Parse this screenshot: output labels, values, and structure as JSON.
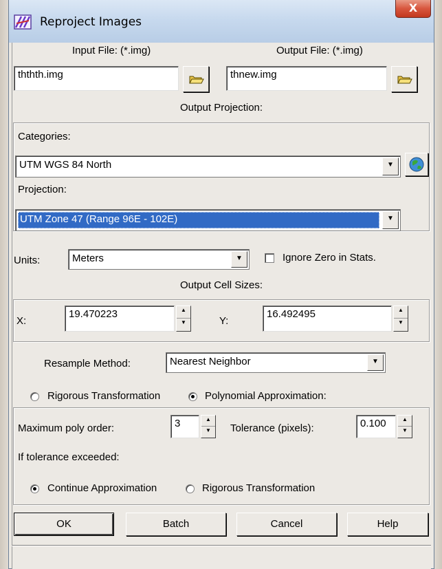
{
  "window": {
    "title": "Reproject Images",
    "close_label": "X"
  },
  "files": {
    "input_label": "Input File: (*.img)",
    "input_value": "ththth.img",
    "output_label": "Output File: (*.img)",
    "output_value": "thnew.img"
  },
  "projection": {
    "section_label": "Output Projection:",
    "categories_label": "Categories:",
    "categories_value": "UTM WGS 84 North",
    "projection_label": "Projection:",
    "projection_value": "UTM Zone 47  (Range 96E - 102E)"
  },
  "units": {
    "label": "Units:",
    "value": "Meters",
    "ignore_zero_label": "Ignore Zero in Stats.",
    "ignore_zero_checked": false
  },
  "cell_sizes": {
    "section_label": "Output Cell Sizes:",
    "x_label": "X:",
    "x_value": "19.470223",
    "y_label": "Y:",
    "y_value": "16.492495"
  },
  "resample": {
    "label": "Resample Method:",
    "value": "Nearest Neighbor"
  },
  "transform": {
    "rigorous_label": "Rigorous Transformation",
    "polynomial_label": "Polynomial Approximation:",
    "selected": "polynomial"
  },
  "polynomial": {
    "max_order_label": "Maximum poly order:",
    "max_order_value": "3",
    "tolerance_label": "Tolerance (pixels):",
    "tolerance_value": "0.100",
    "exceeded_label": "If tolerance exceeded:",
    "continue_label": "Continue Approximation",
    "rigorous_label": "Rigorous Transformation",
    "selected": "continue"
  },
  "buttons": {
    "ok": "OK",
    "batch": "Batch",
    "cancel": "Cancel",
    "help": "Help"
  }
}
